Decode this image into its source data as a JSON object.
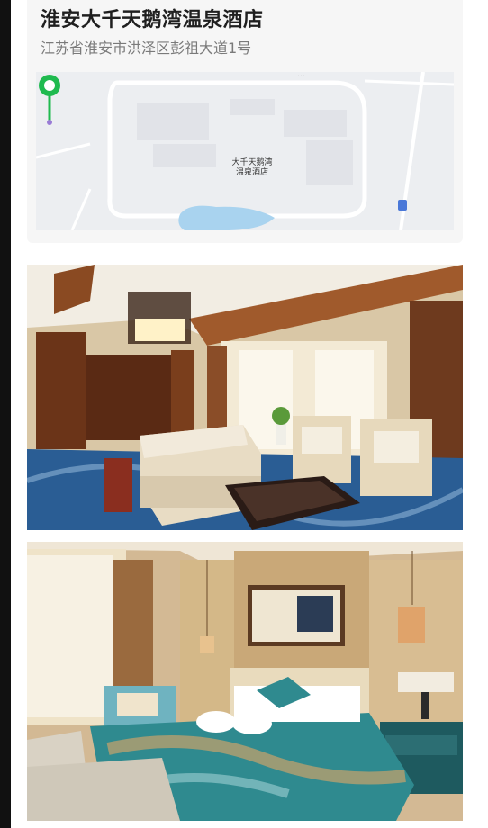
{
  "hotel": {
    "name": "淮安大千天鹅湾温泉酒店",
    "address": "江苏省淮安市洪泽区彭祖大道1号"
  },
  "map": {
    "pin_label_line1": "大千天鹅湾",
    "pin_label_line2": "温泉酒店",
    "pin_color": "#1fba4f",
    "road_label": "…"
  },
  "colors": {
    "accent": "#1fba4f",
    "text_primary": "#1f1f1f",
    "text_secondary": "#7a7a7a"
  },
  "photos": [
    {
      "description_icon": "hotel-living-room-photo"
    },
    {
      "description_icon": "hotel-bedroom-photo"
    }
  ]
}
